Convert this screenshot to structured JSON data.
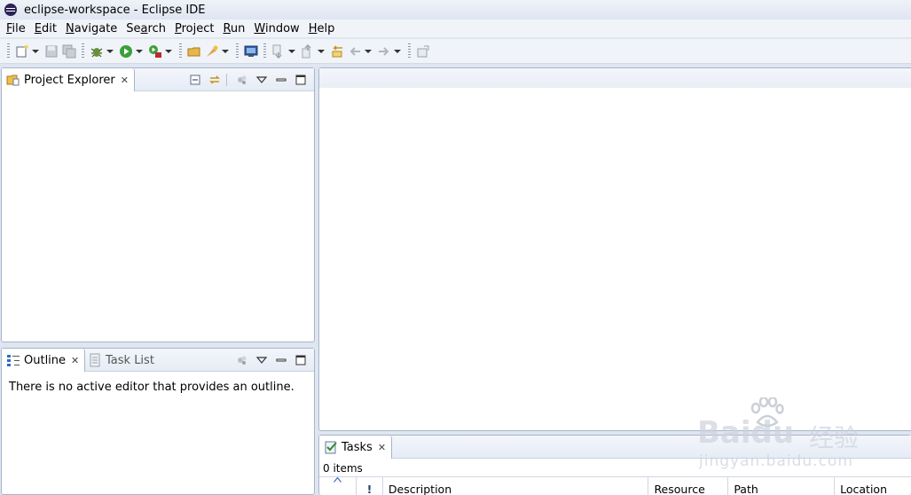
{
  "window": {
    "title": "eclipse-workspace - Eclipse IDE"
  },
  "menu": [
    {
      "u": "F",
      "rest": "ile"
    },
    {
      "u": "E",
      "rest": "dit"
    },
    {
      "u": "N",
      "rest": "avigate"
    },
    {
      "u": "",
      "pre": "Se",
      "uu": "a",
      "post": "rch"
    },
    {
      "u": "P",
      "rest": "roject"
    },
    {
      "u": "R",
      "rest": "un"
    },
    {
      "u": "W",
      "rest": "indow"
    },
    {
      "u": "H",
      "rest": "elp"
    }
  ],
  "menu_labels": {
    "file_u": "F",
    "file_r": "ile",
    "edit_u": "E",
    "edit_r": "dit",
    "nav_u": "N",
    "nav_r": "avigate",
    "search_p": "Se",
    "search_u": "a",
    "search_r": "rch",
    "proj_u": "P",
    "proj_r": "roject",
    "run_u": "R",
    "run_r": "un",
    "win_u": "W",
    "win_r": "indow",
    "help_u": "H",
    "help_r": "elp"
  },
  "project_explorer": {
    "tab_label": "Project Explorer"
  },
  "outline": {
    "tab_label": "Outline",
    "message": "There is no active editor that provides an outline."
  },
  "task_list": {
    "tab_label": "Task List"
  },
  "tasks": {
    "tab_label": "Tasks",
    "count": "0 items",
    "columns": {
      "sort": "",
      "priority": "!",
      "description": "Description",
      "resource": "Resource",
      "path": "Path",
      "location": "Location"
    }
  },
  "watermark": {
    "brand": "Baidu",
    "cn": "经验",
    "url": "jingyan.baidu.com"
  },
  "colors": {
    "accent": "#2c2255",
    "panel_border": "#a8b5c8",
    "window_bg": "#dfe6f1"
  },
  "icons": [
    "eclipse-icon",
    "new-icon",
    "save-icon",
    "save-all-icon",
    "debug-icon",
    "run-icon",
    "external-tools-icon",
    "open-type-icon",
    "open-task-icon",
    "console-icon",
    "next-annotation-icon",
    "prev-annotation-icon",
    "last-edit-icon",
    "back-icon",
    "forward-icon",
    "pin-editor-icon"
  ]
}
